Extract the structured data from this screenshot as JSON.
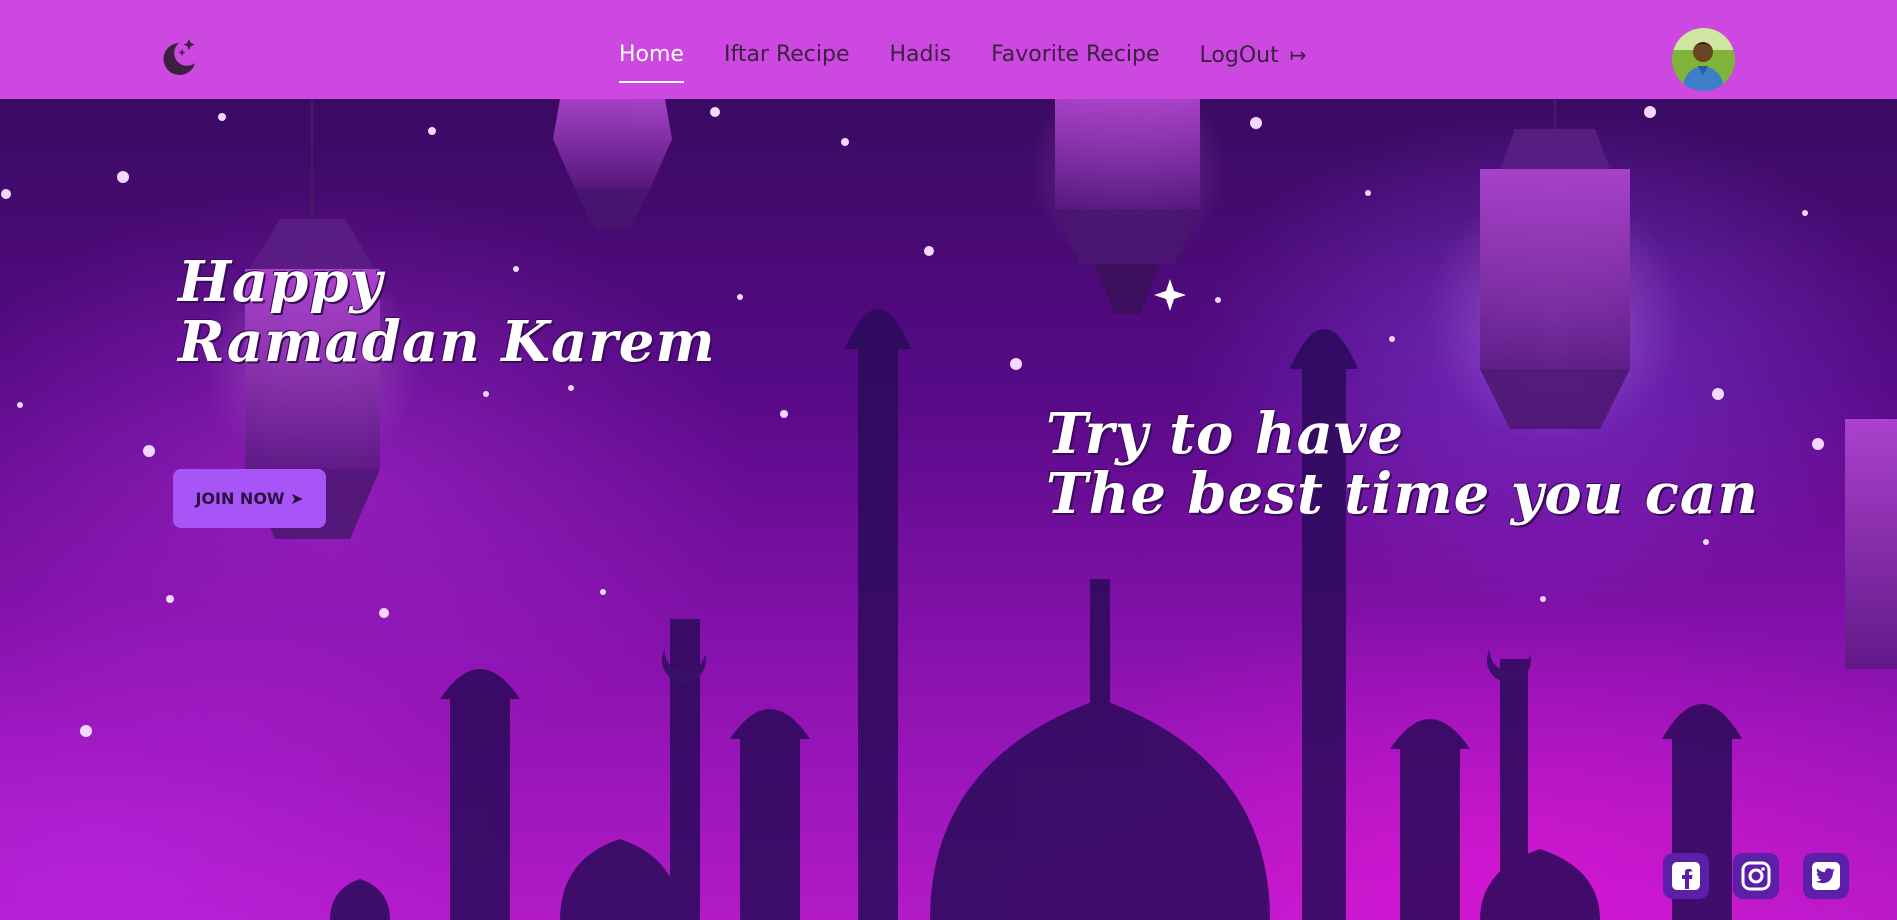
{
  "nav": {
    "logo_icon": "moon-star-icon",
    "links": [
      {
        "label": "Home",
        "active": true
      },
      {
        "label": "Iftar Recipe",
        "active": false
      },
      {
        "label": "Hadis",
        "active": false
      },
      {
        "label": "Favorite Recipe",
        "active": false
      },
      {
        "label": "LogOut",
        "active": false
      }
    ],
    "logout_icon": "logout-arrow-icon",
    "avatar_icon": "user-avatar"
  },
  "hero": {
    "greeting_line1": "Happy",
    "greeting_line2": "Ramadan Karem",
    "join_label": "JOIN NOW ➤",
    "tagline_line1": "Try to have",
    "tagline_line2": "The best time you can"
  },
  "social": [
    {
      "icon": "facebook-icon"
    },
    {
      "icon": "instagram-icon"
    },
    {
      "icon": "twitter-icon"
    }
  ],
  "colors": {
    "navbar": "#cc48e0",
    "button": "#a855f7",
    "social_bg": "#5b1fa8"
  }
}
